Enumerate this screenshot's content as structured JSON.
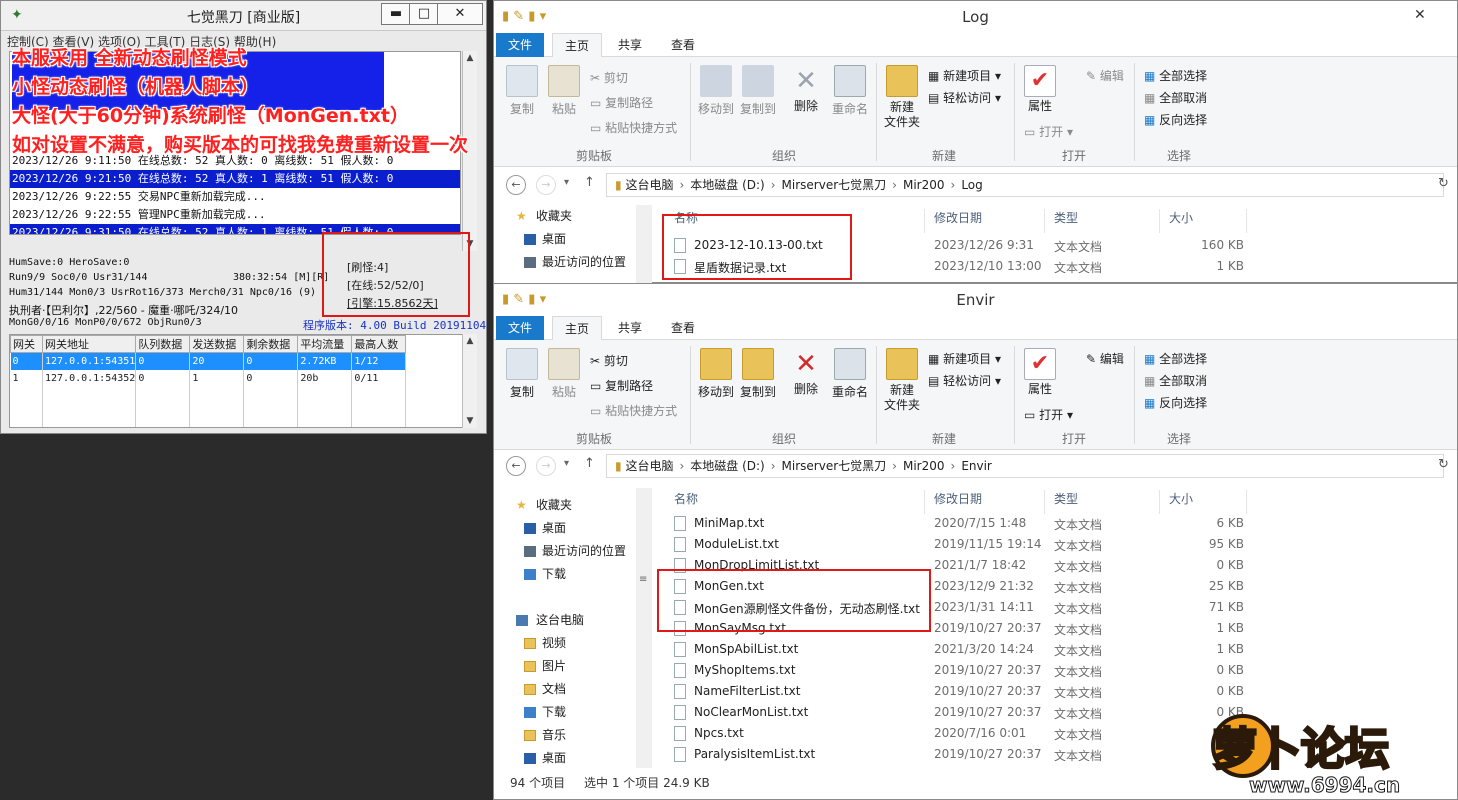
{
  "server": {
    "title": "七觉黑刀 [商业版]",
    "menu": "控制(C)  查看(V)  选项(O)  工具(T)  日志(S)  帮助(H)",
    "log_lines": [
      {
        "text": "2023/12/26 9:11:50 在线总数: 52 真人数: 0 离线数: 51 假人数: 0",
        "selected": false
      },
      {
        "text": "2023/12/26 9:21:50 在线总数: 52 真人数: 1 离线数: 51 假人数: 0",
        "selected": true
      },
      {
        "text": "2023/12/26 9:22:55 交易NPC重新加载完成...",
        "selected": false
      },
      {
        "text": "2023/12/26 9:22:55 管理NPC重新加载完成...",
        "selected": false
      },
      {
        "text": "2023/12/26 9:31:50 在线总数: 52 真人数: 1 离线数: 51 假人数: 0",
        "selected": true
      }
    ],
    "stats": {
      "l1": "HumSave:0 HeroSave:0",
      "l2": "Run9/9 Soc0/0 Usr31/144",
      "l2b": "380:32:54 [M][R]",
      "l3": "Hum31/144 Mon0/3 UsrRot16/373 Merch0/31 Npc0/16 (9)",
      "l4": "执刑者·【巴利尔】,22/560 - 魔重·哪吒/324/10",
      "l5": "MonG0/0/16 MonP0/0/672 ObjRun0/3",
      "version": "程序版本: 4.00 Build 20191104"
    },
    "counters": [
      "[刷怪:4]",
      "[在线:52/52/0]",
      "[引擎:15.8562天]"
    ],
    "gateway": {
      "headers": [
        "网关",
        "网关地址",
        "队列数据",
        "发送数据",
        "剩余数据",
        "平均流量",
        "最高人数"
      ],
      "rows": [
        [
          "0",
          "127.0.0.1:54351",
          "0",
          "20",
          "0",
          "2.72KB",
          "1/12"
        ],
        [
          "1",
          "127.0.0.1:54352",
          "0",
          "1",
          "0",
          "20b",
          "0/11"
        ]
      ]
    }
  },
  "overlay_text": [
    "本服采用 全新动态刷怪模式",
    "小怪动态刷怪（机器人脚本）",
    "大怪(大于60分钟)系统刷怪（MonGen.txt）",
    "如对设置不满意，购买版本的可找我免费重新设置一次"
  ],
  "ribbon": {
    "tabs": [
      "文件",
      "主页",
      "共享",
      "查看"
    ],
    "clipboard": {
      "copy": "复制",
      "paste": "粘贴",
      "cut": "剪切",
      "copy_path": "复制路径",
      "paste_shortcut": "粘贴快捷方式",
      "group": "剪贴板"
    },
    "organize": {
      "move_to": "移动到",
      "copy_to": "复制到",
      "delete": "删除",
      "rename": "重命名",
      "group": "组织"
    },
    "new": {
      "new_folder": "新建\n文件夹",
      "new_item": "新建项目",
      "easy_access": "轻松访问",
      "group": "新建"
    },
    "open": {
      "properties": "属性",
      "open": "打开",
      "edit": "编辑",
      "group": "打开"
    },
    "select": {
      "select_all": "全部选择",
      "select_none": "全部取消",
      "invert": "反向选择",
      "group": "选择"
    }
  },
  "nav": {
    "favorites": "收藏夹",
    "desktop": "桌面",
    "recent": "最近访问的位置",
    "downloads": "下载",
    "this_pc": "这台电脑",
    "videos": "视频",
    "pictures": "图片",
    "documents": "文档",
    "downloads2": "下载",
    "music": "音乐",
    "desktop2": "桌面"
  },
  "columns": [
    "名称",
    "修改日期",
    "类型",
    "大小"
  ],
  "log_window": {
    "title": "Log",
    "path": [
      "这台电脑",
      "本地磁盘 (D:)",
      "Mirserver七觉黑刀",
      "Mir200",
      "Log"
    ],
    "files": [
      {
        "name": "2023-12-10.13-00.txt",
        "date": "2023/12/26 9:31",
        "type": "文本文档",
        "size": "160 KB"
      },
      {
        "name": "星盾数据记录.txt",
        "date": "2023/12/10 13:00",
        "type": "文本文档",
        "size": "1 KB"
      }
    ]
  },
  "envir_window": {
    "title": "Envir",
    "path": [
      "这台电脑",
      "本地磁盘 (D:)",
      "Mirserver七觉黑刀",
      "Mir200",
      "Envir"
    ],
    "files": [
      {
        "name": "MiniMap.txt",
        "date": "2020/7/15 1:48",
        "type": "文本文档",
        "size": "6 KB"
      },
      {
        "name": "ModuleList.txt",
        "date": "2019/11/15 19:14",
        "type": "文本文档",
        "size": "95 KB"
      },
      {
        "name": "MonDropLimitList.txt",
        "date": "2021/1/7 18:42",
        "type": "文本文档",
        "size": "0 KB"
      },
      {
        "name": "MonGen.txt",
        "date": "2023/12/9 21:32",
        "type": "文本文档",
        "size": "25 KB"
      },
      {
        "name": "MonGen源刷怪文件备份，无动态刷怪.txt",
        "date": "2023/1/31 14:11",
        "type": "文本文档",
        "size": "71 KB"
      },
      {
        "name": "MonSayMsg.txt",
        "date": "2019/10/27 20:37",
        "type": "文本文档",
        "size": "1 KB"
      },
      {
        "name": "MonSpAbilList.txt",
        "date": "2021/3/20 14:24",
        "type": "文本文档",
        "size": "1 KB"
      },
      {
        "name": "MyShopItems.txt",
        "date": "2019/10/27 20:37",
        "type": "文本文档",
        "size": "0 KB"
      },
      {
        "name": "NameFilterList.txt",
        "date": "2019/10/27 20:37",
        "type": "文本文档",
        "size": "0 KB"
      },
      {
        "name": "NoClearMonList.txt",
        "date": "2019/10/27 20:37",
        "type": "文本文档",
        "size": "0 KB"
      },
      {
        "name": "Npcs.txt",
        "date": "2020/7/16 0:01",
        "type": "文本文档",
        "size": "0 KB"
      },
      {
        "name": "ParalysisItemList.txt",
        "date": "2019/10/27 20:37",
        "type": "文本文档",
        "size": "0 KB"
      }
    ],
    "status_count": "94 个项目",
    "status_selected": "选中 1 个项目  24.9 KB"
  },
  "watermark": {
    "name": "萝卜论坛",
    "url": "www.6994.cn"
  },
  "colors": {
    "accent": "#1979ca",
    "highlight_blue": "#0a1ecd",
    "annotation_red": "#e01818"
  }
}
